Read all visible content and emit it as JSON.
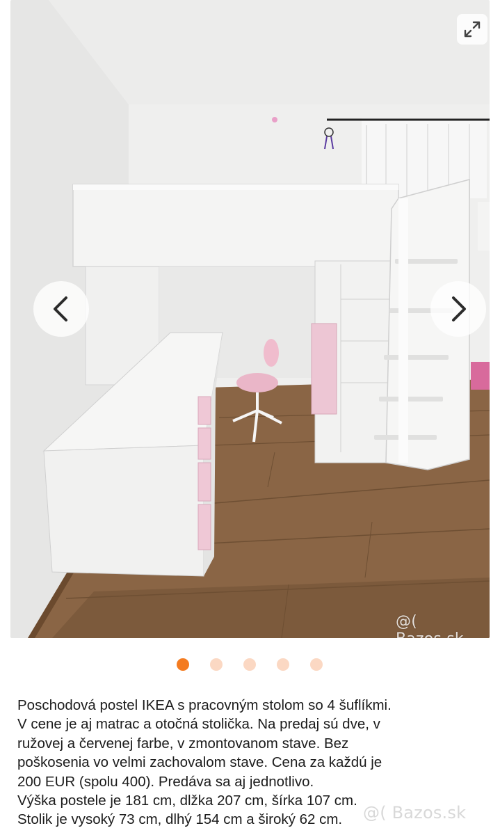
{
  "gallery": {
    "photo_alt": "Poschodová postel IKEA s pracovným stolom",
    "watermark": "@( Bazos.sk",
    "icons": {
      "expand": "expand-arrows-icon",
      "prev": "chevron-left-icon",
      "next": "chevron-right-icon"
    },
    "pagination": {
      "total": 5,
      "active_index": 0
    },
    "colors": {
      "active_dot": "#f47b20",
      "inactive_dot": "#fbd8c3"
    }
  },
  "description": {
    "text": "Poschodová postel IKEA s pracovným stolom so 4 šuflíkmi.\nV cene je aj matrac a otočná stolička. Na predaj sú dve, v\nružovej a červenej farbe, v zmontovanom stave. Bez\npoškosenia vo velmi zachovalom stave. Cena za každú je\n200 EUR (spolu 400). Predáva sa aj jednotlivo.\nVýška postele je 181 cm, dlžka 207 cm, šírka 107 cm.\nStolik je vysoký 73 cm, dlhý 154 cm a široký 62 cm."
  },
  "page_watermark": "@( Bazos.sk"
}
